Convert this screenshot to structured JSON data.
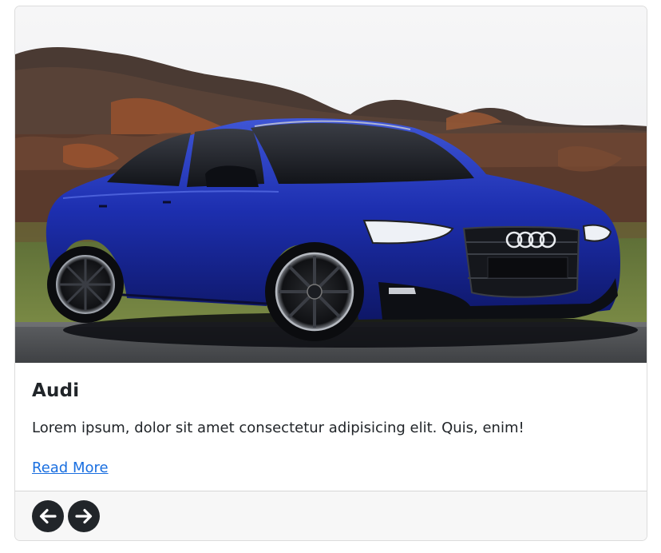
{
  "card": {
    "image_alt": "Blue Audi A5 Sportback parked on a road in front of a hedge and trees",
    "title": "Audi",
    "text": "Lorem ipsum, dolor sit amet consectetur adipisicing elit. Quis, enim!",
    "link_label": "Read More"
  },
  "footer": {
    "prev_icon": "arrow-left-circle-icon",
    "next_icon": "arrow-right-circle-icon"
  },
  "colors": {
    "link": "#1a6fe0",
    "button": "#212529",
    "footer_bg": "#f7f7f7",
    "text": "#212529"
  }
}
